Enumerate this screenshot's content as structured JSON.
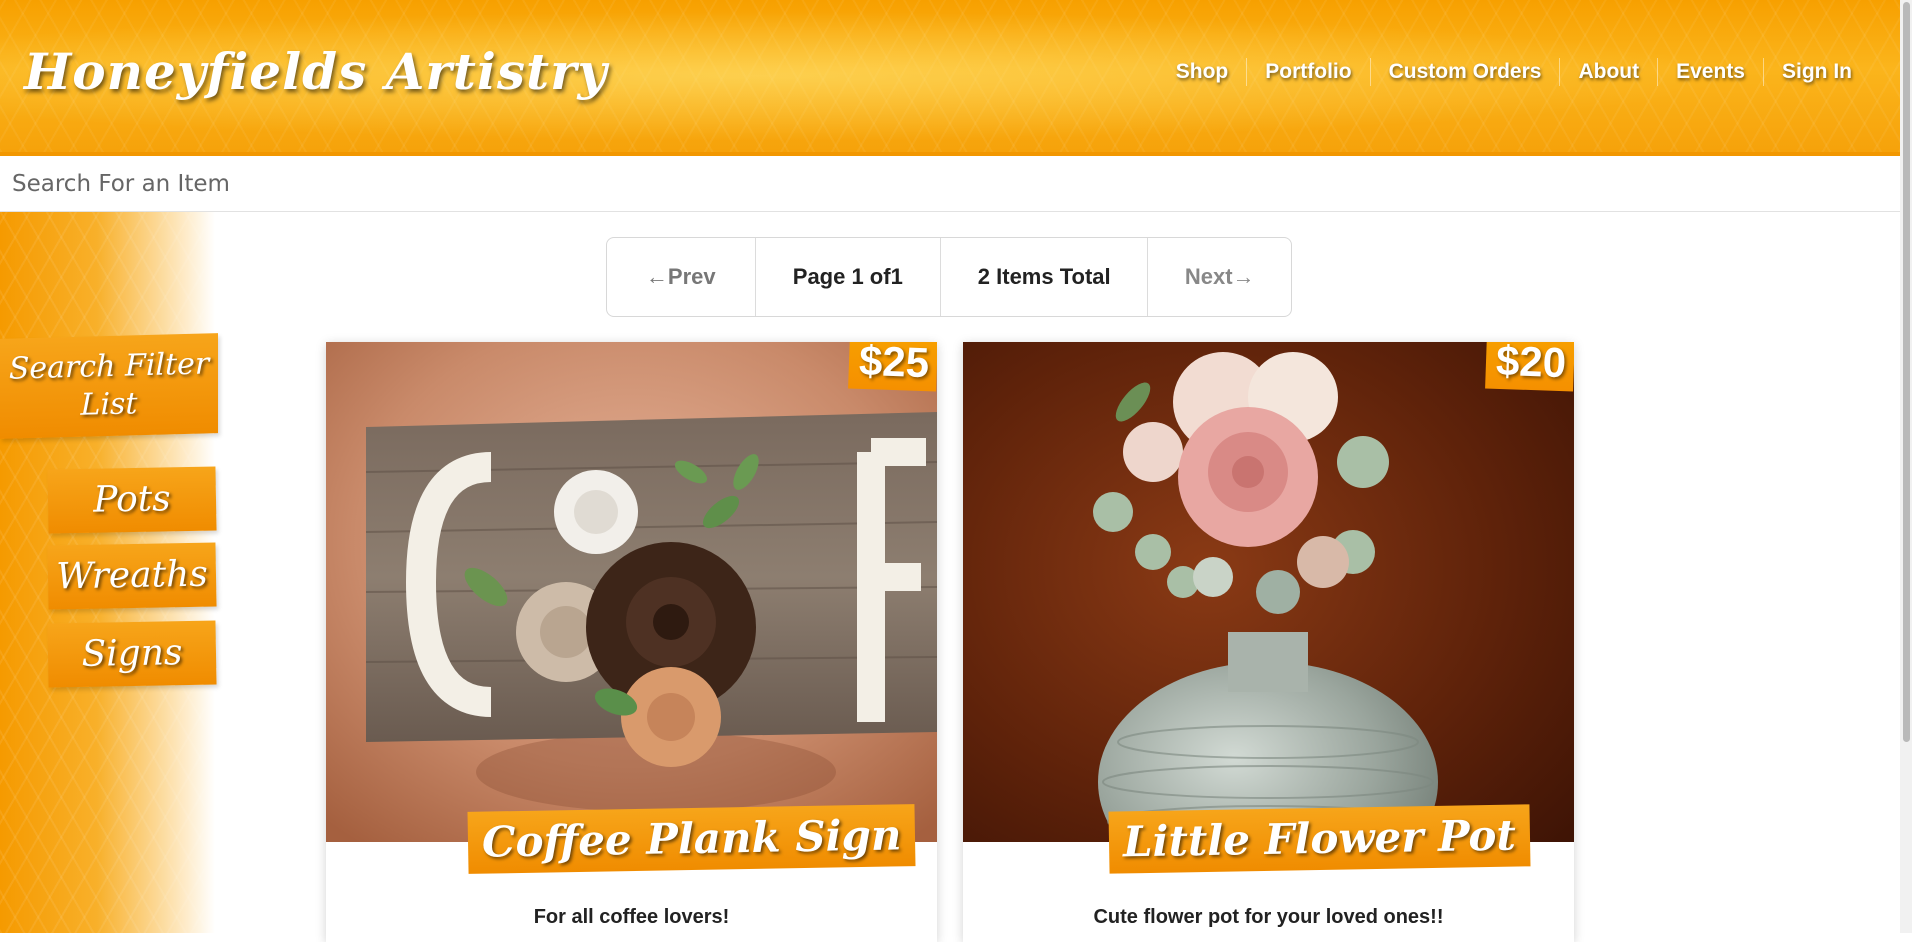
{
  "header": {
    "logo": "Honeyfields Artistry",
    "nav": [
      "Shop",
      "Portfolio",
      "Custom Orders",
      "About",
      "Events",
      "Sign In"
    ]
  },
  "search": {
    "placeholder": "Search For an Item"
  },
  "sidebar": {
    "filter_title": "Search Filter List",
    "items": [
      "Pots",
      "Wreaths",
      "Signs"
    ]
  },
  "pagination": {
    "prev": "Prev",
    "page": "Page 1 of1",
    "total": "2 Items Total",
    "next": "Next",
    "prev_icon": "arrow-left-icon",
    "next_icon": "arrow-right-icon"
  },
  "products": [
    {
      "title": "Coffee Plank Sign",
      "price": "$25",
      "description": "For all coffee lovers!"
    },
    {
      "title": "Little Flower Pot",
      "price": "$20",
      "description": "Cute flower pot for your loved ones!!"
    }
  ],
  "colors": {
    "accent": "#f7a000",
    "accent_dark": "#f08c00"
  }
}
